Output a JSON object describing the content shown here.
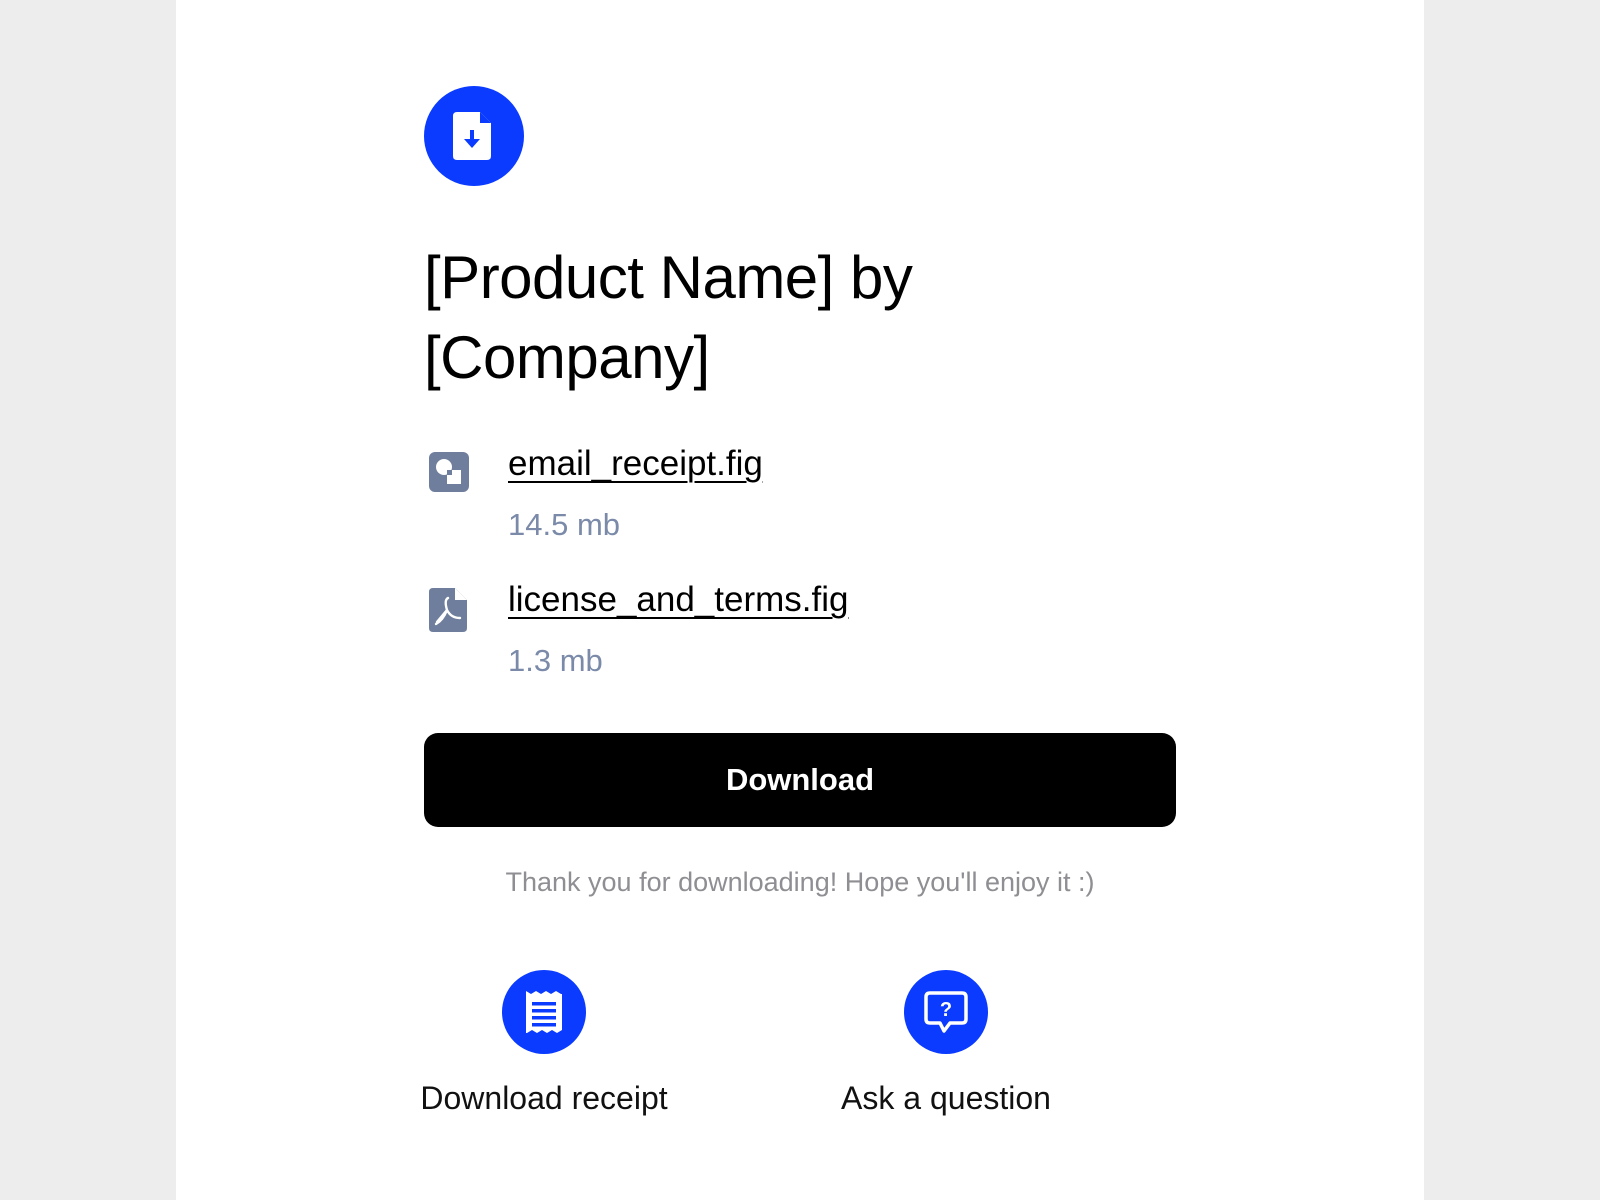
{
  "page": {
    "title": "[Product Name] by [Company]",
    "hero_icon": "file-download-icon"
  },
  "files": [
    {
      "name": "email_receipt.fig",
      "size": "14.5 mb",
      "icon": "figma-file-icon"
    },
    {
      "name": "license_and_terms.fig",
      "size": "1.3 mb",
      "icon": "pdf-file-icon"
    }
  ],
  "download_button": {
    "label": "Download"
  },
  "thanks_message": "Thank you for downloading! Hope you'll enjoy it :)",
  "actions": [
    {
      "label": "Download receipt",
      "icon": "receipt-icon"
    },
    {
      "label": "Ask a question",
      "icon": "question-chat-icon"
    }
  ],
  "colors": {
    "accent": "#0a3bff",
    "background": "#ededed",
    "card": "#ffffff",
    "muted_text": "#7a8aa8",
    "button": "#000000"
  }
}
